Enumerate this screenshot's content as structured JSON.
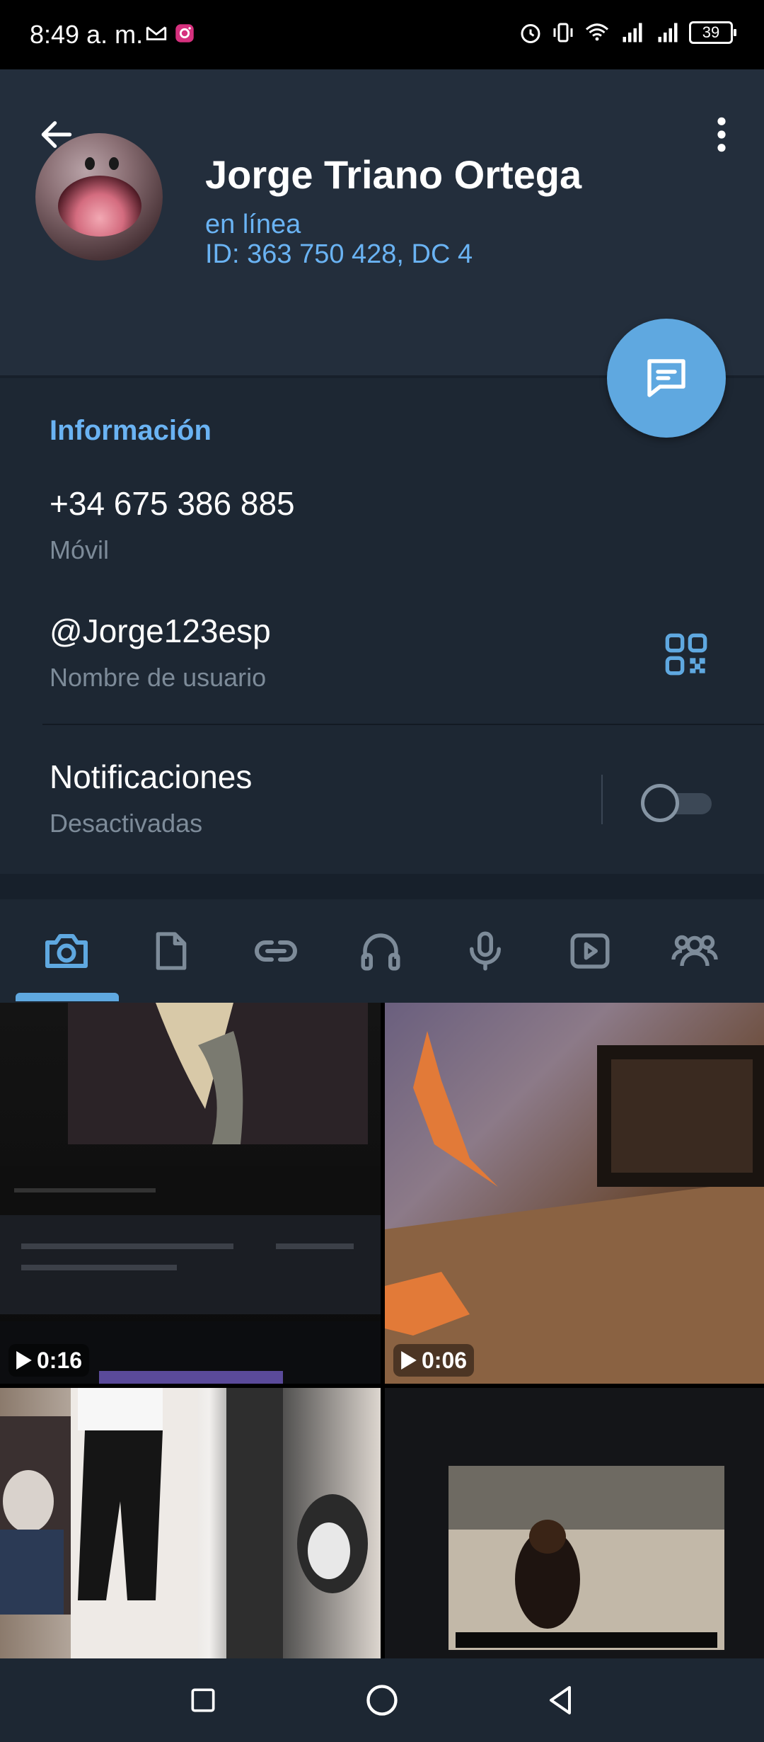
{
  "status_bar": {
    "time": "8:49 a. m.",
    "battery": "39",
    "icons": [
      "gmail-icon",
      "instagram-icon",
      "alarm-icon",
      "vibrate-icon",
      "wifi-icon",
      "signal-icon",
      "signal-icon"
    ]
  },
  "header": {
    "name": "Jorge Triano Ortega",
    "presence": "en línea",
    "id_line": "ID: 363 750 428, DC 4"
  },
  "info": {
    "section_title": "Información",
    "phone": "+34 675 386 885",
    "phone_label": "Móvil",
    "username": "@Jorge123esp",
    "username_label": "Nombre de usuario",
    "notifications": "Notificaciones",
    "notifications_state": "Desactivadas",
    "notifications_enabled": false
  },
  "tabs": {
    "items": [
      "camera-icon",
      "file-icon",
      "link-icon",
      "headphones-icon",
      "microphone-icon",
      "video-icon",
      "groups-icon"
    ],
    "selected_index": 0
  },
  "media": {
    "items": [
      {
        "duration": "0:16"
      },
      {
        "duration": "0:06"
      },
      {
        "duration": ""
      },
      {
        "duration": ""
      }
    ]
  },
  "colors": {
    "accent": "#6ab3f3",
    "fab": "#5fa8e0",
    "background": "#1d2733",
    "header": "#232e3c"
  }
}
